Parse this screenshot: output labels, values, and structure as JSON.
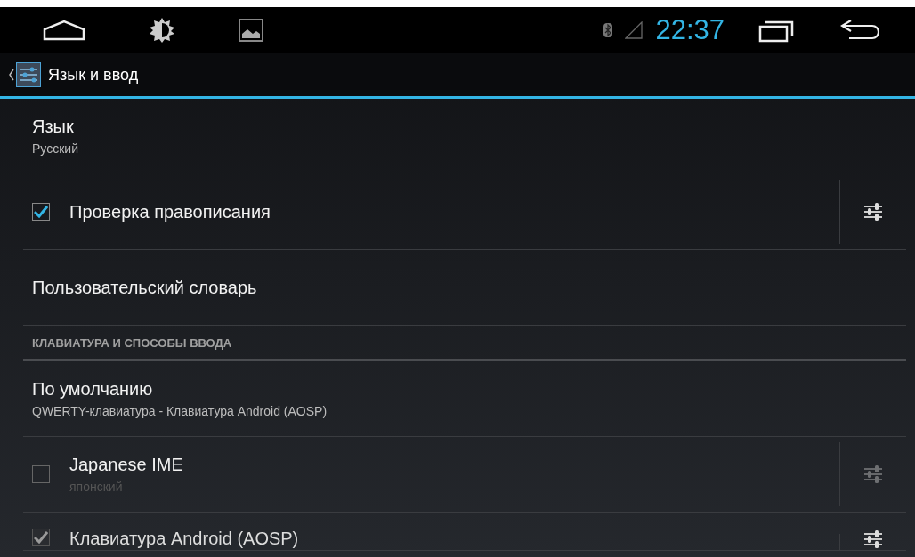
{
  "status_bar": {
    "time": "22:37"
  },
  "action_bar": {
    "title": "Язык и ввод"
  },
  "items": [
    {
      "kind": "text",
      "title": "Язык",
      "summary": "Русский"
    },
    {
      "kind": "check",
      "title": "Проверка правописания",
      "checked": true,
      "disabled": false,
      "settings_enabled": true
    },
    {
      "kind": "text",
      "title": "Пользовательский словарь"
    },
    {
      "kind": "header",
      "title": "КЛАВИАТУРА И СПОСОБЫ ВВОДА"
    },
    {
      "kind": "text",
      "title": "По умолчанию",
      "summary": "QWERTY-клавиатура - Клавиатура Android (AOSP)"
    },
    {
      "kind": "check",
      "title": "Japanese IME",
      "summary": "японский",
      "checked": false,
      "disabled": false,
      "settings_enabled": false
    },
    {
      "kind": "check",
      "title": "Клавиатура Android (AOSP)",
      "checked": true,
      "disabled": true,
      "settings_enabled": true
    }
  ]
}
